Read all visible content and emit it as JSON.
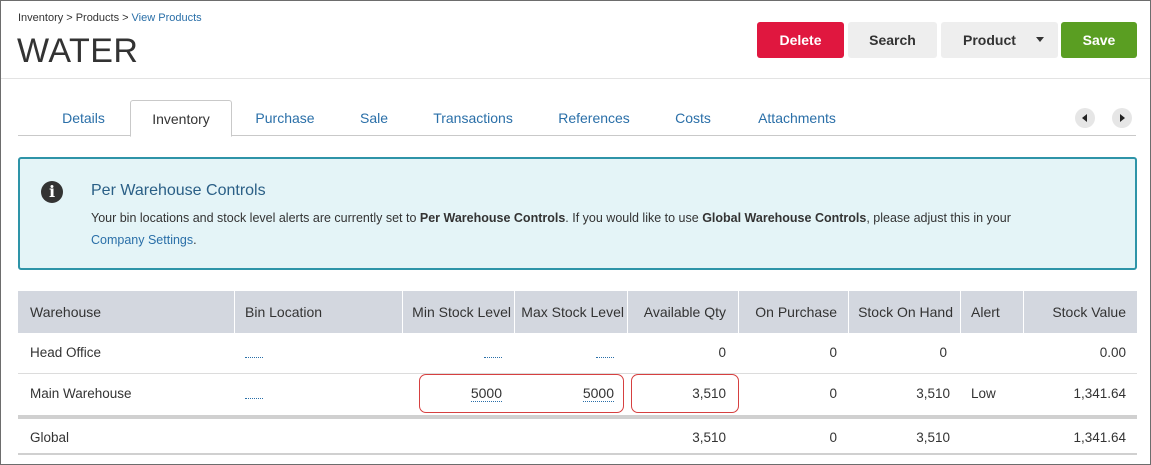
{
  "breadcrumb": {
    "items": [
      "Inventory",
      "Products",
      "View Products"
    ],
    "separator": ">"
  },
  "page": {
    "title": "WATER"
  },
  "toolbar": {
    "delete_label": "Delete",
    "search_label": "Search",
    "product_label": "Product",
    "save_label": "Save"
  },
  "tabs": [
    {
      "label": "Details",
      "active": false
    },
    {
      "label": "Inventory",
      "active": true
    },
    {
      "label": "Purchase",
      "active": false
    },
    {
      "label": "Sale",
      "active": false
    },
    {
      "label": "Transactions",
      "active": false
    },
    {
      "label": "References",
      "active": false
    },
    {
      "label": "Costs",
      "active": false
    },
    {
      "label": "Attachments",
      "active": false
    }
  ],
  "info": {
    "icon": "info-icon",
    "title": "Per Warehouse Controls",
    "text_1": "Your bin locations and stock level alerts are currently set to ",
    "bold_1": "Per Warehouse Controls",
    "text_2": ". If you would like to use ",
    "bold_2": "Global Warehouse Controls",
    "text_3": ", please adjust this in your",
    "link": "Company Settings",
    "text_4": "."
  },
  "table": {
    "headers": [
      "Warehouse",
      "Bin Location",
      "Min Stock Level",
      "Max Stock Level",
      "Available Qty",
      "On Purchase",
      "Stock On Hand",
      "Alert",
      "Stock Value"
    ],
    "rows": [
      {
        "warehouse": "Head Office",
        "bin": "",
        "min": "",
        "max": "",
        "available": "0",
        "on_purchase": "0",
        "on_hand": "0",
        "alert": "",
        "value": "0.00"
      },
      {
        "warehouse": "Main Warehouse",
        "bin": "",
        "min": "5000",
        "max": "5000",
        "available": "3,510",
        "on_purchase": "0",
        "on_hand": "3,510",
        "alert": "Low",
        "value": "1,341.64"
      }
    ],
    "total": {
      "warehouse": "Global",
      "available": "3,510",
      "on_purchase": "0",
      "on_hand": "3,510",
      "value": "1,341.64"
    }
  },
  "colors": {
    "delete": "#e0173f",
    "save": "#5a9e22",
    "link": "#2a6fa8",
    "info_border": "#2e94a8",
    "info_bg": "#e4f4f7",
    "highlight": "#d64040"
  }
}
